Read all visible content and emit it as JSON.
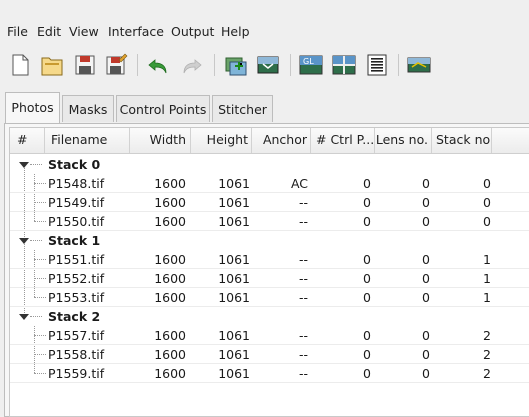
{
  "menu": [
    "File",
    "Edit",
    "View",
    "Interface",
    "Output",
    "Help"
  ],
  "toolbar": {
    "icons": [
      "new-icon",
      "open-icon",
      "save-icon",
      "save-as-icon",
      "undo-icon",
      "redo-icon",
      "add-images-icon",
      "remove-images-icon",
      "gl-preview-icon",
      "fast-preview-icon",
      "layout-icon",
      "stitch-icon"
    ]
  },
  "tabs": [
    "Photos",
    "Masks",
    "Control Points",
    "Stitcher"
  ],
  "table": {
    "headers": [
      "#",
      "Filename",
      "Width",
      "Height",
      "Anchor",
      "# Ctrl P...",
      "Lens no.",
      "Stack no."
    ],
    "groups": [
      {
        "label": "Stack 0",
        "rows": [
          [
            "P1548.tif",
            "1600",
            "1061",
            "AC",
            "0",
            "0",
            "0"
          ],
          [
            "P1549.tif",
            "1600",
            "1061",
            "--",
            "0",
            "0",
            "0"
          ],
          [
            "P1550.tif",
            "1600",
            "1061",
            "--",
            "0",
            "0",
            "0"
          ]
        ]
      },
      {
        "label": "Stack 1",
        "rows": [
          [
            "P1551.tif",
            "1600",
            "1061",
            "--",
            "0",
            "0",
            "1"
          ],
          [
            "P1552.tif",
            "1600",
            "1061",
            "--",
            "0",
            "0",
            "1"
          ],
          [
            "P1553.tif",
            "1600",
            "1061",
            "--",
            "0",
            "0",
            "1"
          ]
        ]
      },
      {
        "label": "Stack 2",
        "rows": [
          [
            "P1557.tif",
            "1600",
            "1061",
            "--",
            "0",
            "0",
            "2"
          ],
          [
            "P1558.tif",
            "1600",
            "1061",
            "--",
            "0",
            "0",
            "2"
          ],
          [
            "P1559.tif",
            "1600",
            "1061",
            "--",
            "0",
            "0",
            "2"
          ]
        ]
      }
    ]
  },
  "colors": {
    "accent": "#1e5aa8",
    "header_bg": "#efefef"
  }
}
